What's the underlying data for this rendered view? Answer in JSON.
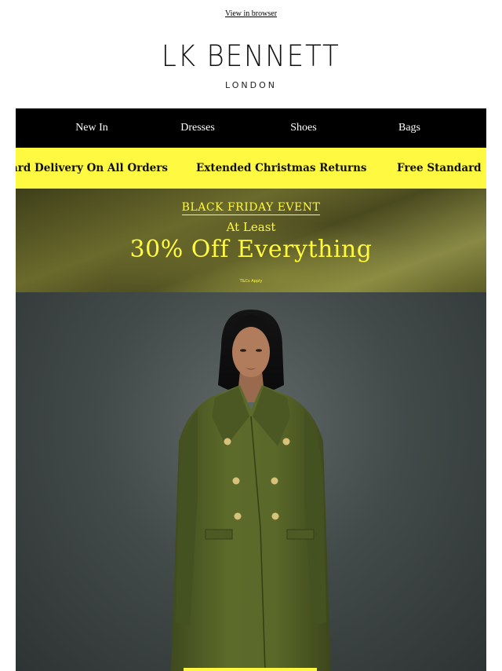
{
  "header": {
    "view_in_browser": "View in browser",
    "logo_main": "LK BENNETT",
    "logo_sub": "LONDON"
  },
  "nav": {
    "items": [
      {
        "label": "New In"
      },
      {
        "label": "Dresses"
      },
      {
        "label": "Shoes"
      },
      {
        "label": "Bags"
      }
    ]
  },
  "ticker": {
    "items": [
      "ard Delivery On All Orders",
      "Extended Christmas Returns",
      "Free Standard"
    ],
    "background": "#fff941"
  },
  "promo": {
    "event": "BLACK FRIDAY EVENT",
    "subheading": "At Least",
    "headline": "30% Off Everything",
    "terms": "T&Cs Apply",
    "text_color": "#fff941"
  },
  "hero": {
    "image": "model-in-green-double-breasted-coat"
  }
}
